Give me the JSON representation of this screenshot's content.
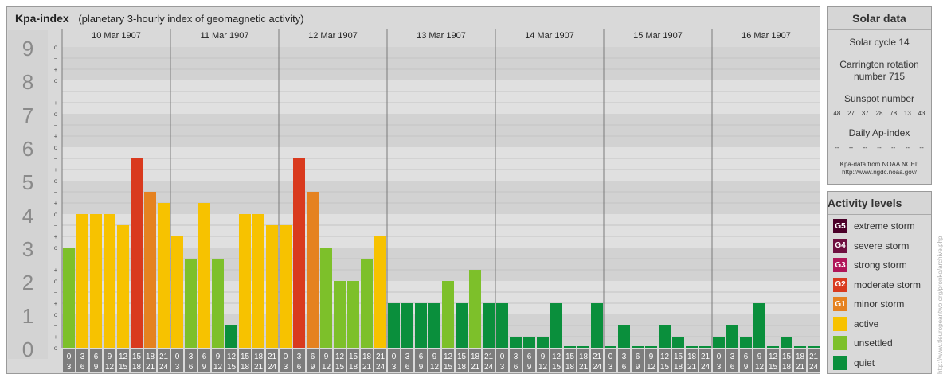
{
  "header": {
    "title": "Kpa-index",
    "subtitle": "(planetary 3-hourly index of geomagnetic activity)"
  },
  "chart_data": {
    "type": "bar",
    "title": "Kpa-index",
    "subtitle": "(planetary 3-hourly index of geomagnetic activity)",
    "ylim": [
      0,
      9
    ],
    "y_ticks": [
      "0",
      "1",
      "2",
      "3",
      "4",
      "5",
      "6",
      "7",
      "8",
      "9"
    ],
    "sub_ticks": [
      "o",
      "+",
      "−"
    ],
    "days": [
      "10 Mar 1907",
      "11 Mar 1907",
      "12 Mar 1907",
      "13 Mar 1907",
      "14 Mar 1907",
      "15 Mar 1907",
      "16 Mar 1907"
    ],
    "interval_labels_top": [
      "0",
      "3",
      "6",
      "9",
      "12",
      "15",
      "18",
      "21"
    ],
    "interval_labels_bottom": [
      "3",
      "6",
      "9",
      "12",
      "15",
      "18",
      "21",
      "24"
    ],
    "values": [
      [
        3.0,
        4.0,
        4.0,
        4.0,
        3.667,
        5.667,
        4.667,
        4.333
      ],
      [
        3.333,
        2.667,
        4.333,
        2.667,
        0.667,
        4.0,
        4.0,
        3.667
      ],
      [
        3.667,
        5.667,
        4.667,
        3.0,
        2.0,
        2.0,
        2.667,
        3.333
      ],
      [
        1.333,
        1.333,
        1.333,
        1.333,
        2.0,
        1.333,
        2.333,
        1.333
      ],
      [
        1.333,
        0.333,
        0.333,
        0.333,
        1.333,
        0.0,
        0.0,
        1.333
      ],
      [
        0.0,
        0.667,
        0.0,
        0.0,
        0.667,
        0.333,
        0.0,
        0.0
      ],
      [
        0.333,
        0.667,
        0.333,
        1.333,
        0.0,
        0.333,
        0.0,
        0.0
      ]
    ],
    "colors": {
      "quiet": "#0a8f3c",
      "unsettled": "#7dc02a",
      "active": "#f7c200",
      "G1": "#e58220",
      "G2": "#d93a1e",
      "G3": "#b01558",
      "G4": "#6e0f3f",
      "G5": "#4a0028"
    }
  },
  "solar": {
    "title": "Solar data",
    "cycle": "Solar cycle 14",
    "rotation_line1": "Carrington rotation",
    "rotation_line2": "number 715",
    "sunspot_title": "Sunspot number",
    "sunspots": [
      "48",
      "27",
      "37",
      "28",
      "78",
      "13",
      "43"
    ],
    "ap_title": "Daily Ap-index",
    "ap_values": [
      "--",
      "--",
      "--",
      "--",
      "--",
      "--",
      "--"
    ],
    "credit_line1": "Kpa-data from NOAA NCEI:",
    "credit_line2": "http://www.ngdc.noaa.gov/"
  },
  "activity": {
    "title": "Activity levels",
    "levels": [
      {
        "badge": "G5",
        "label": "extreme storm",
        "color": "#4a0028"
      },
      {
        "badge": "G4",
        "label": "severe storm",
        "color": "#6e0f3f"
      },
      {
        "badge": "G3",
        "label": "strong storm",
        "color": "#b01558"
      },
      {
        "badge": "G2",
        "label": "moderate storm",
        "color": "#d93a1e"
      },
      {
        "badge": "G1",
        "label": "minor storm",
        "color": "#e58220"
      },
      {
        "badge": "",
        "label": "active",
        "color": "#f7c200"
      },
      {
        "badge": "",
        "label": "unsettled",
        "color": "#7dc02a"
      },
      {
        "badge": "",
        "label": "quiet",
        "color": "#0a8f3c"
      }
    ]
  },
  "watermark": "http://www.tleuropeantwo.org/pronko/archive.php"
}
